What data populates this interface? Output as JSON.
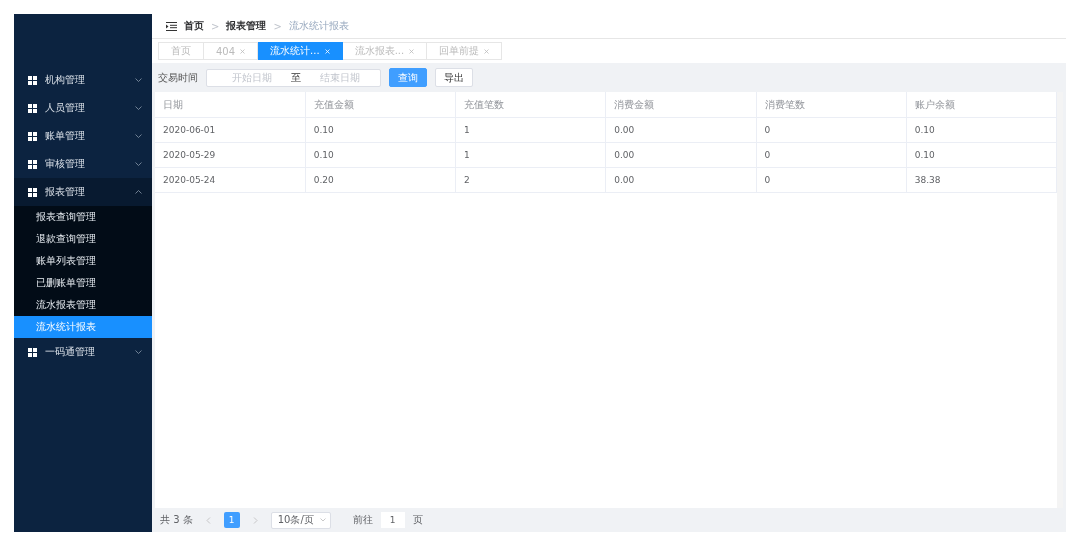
{
  "sidebar": {
    "items": [
      {
        "label": "机构管理",
        "expanded": false
      },
      {
        "label": "人员管理",
        "expanded": false
      },
      {
        "label": "账单管理",
        "expanded": false
      },
      {
        "label": "审核管理",
        "expanded": false
      },
      {
        "label": "报表管理",
        "expanded": true,
        "children": [
          {
            "label": "报表查询管理",
            "selected": false
          },
          {
            "label": "退款查询管理",
            "selected": false
          },
          {
            "label": "账单列表管理",
            "selected": false
          },
          {
            "label": "已删账单管理",
            "selected": false
          },
          {
            "label": "流水报表管理",
            "selected": false
          },
          {
            "label": "流水统计报表",
            "selected": true
          }
        ]
      },
      {
        "label": "一码通管理",
        "expanded": false
      }
    ]
  },
  "breadcrumb": [
    {
      "label": "首页",
      "current": false
    },
    {
      "label": "报表管理",
      "current": false
    },
    {
      "label": "流水统计报表",
      "current": true
    }
  ],
  "breadcrumb_separator": ">",
  "tabs": [
    {
      "label": "首页",
      "selected": false,
      "closable": false
    },
    {
      "label": "404",
      "selected": false,
      "closable": true
    },
    {
      "label": "流水统计...",
      "selected": true,
      "closable": true
    },
    {
      "label": "流水报表...",
      "selected": false,
      "closable": true
    },
    {
      "label": "回单前提",
      "selected": false,
      "closable": true
    }
  ],
  "filter": {
    "label": "交易时间",
    "start": {
      "placeholder": "开始日期"
    },
    "separator": "至",
    "end": {
      "placeholder": "结束日期"
    },
    "buttons": [
      {
        "label": "查询",
        "primary": true
      },
      {
        "label": "导出",
        "primary": false
      }
    ]
  },
  "table": {
    "columns": [
      "日期",
      "充值金额",
      "充值笔数",
      "消费金额",
      "消费笔数",
      "账户余额"
    ],
    "rows": [
      [
        "2020-06-01",
        "0.10",
        "1",
        "0.00",
        "0",
        "0.10"
      ],
      [
        "2020-05-29",
        "0.10",
        "1",
        "0.00",
        "0",
        "0.10"
      ],
      [
        "2020-05-24",
        "0.20",
        "2",
        "0.00",
        "0",
        "38.38"
      ]
    ]
  },
  "pagination": {
    "total": "共 3 条",
    "pages": [
      {
        "label": "1",
        "selected": true
      }
    ],
    "page_size": "10条/页",
    "goto_label": "前往",
    "goto_value": "1",
    "goto_suffix": "页"
  }
}
